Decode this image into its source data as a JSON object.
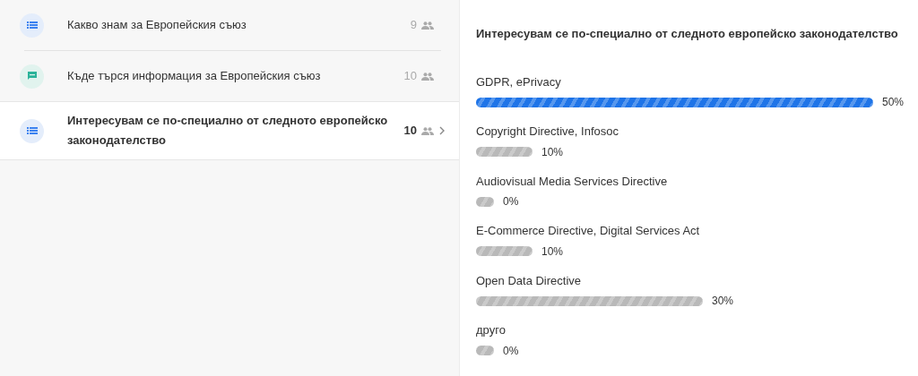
{
  "questions": [
    {
      "kind": "list",
      "title": "Какво знам за Европейския съюз",
      "count": "9",
      "selected": false
    },
    {
      "kind": "chat",
      "title": "Къде търся информация за Европейския съюз",
      "count": "10",
      "selected": false
    },
    {
      "kind": "list",
      "title": "Интересувам се по-специално от следното европейско законодателство",
      "count": "10",
      "selected": true
    }
  ],
  "results": {
    "title": "Интересувам се по-специално от следното европейско законодателство",
    "options": [
      {
        "label": "GDPR, ePrivacy",
        "reading": "50%",
        "leading": true
      },
      {
        "label": "Copyright Directive, Infosoc",
        "reading": "10%",
        "leading": false
      },
      {
        "label": "Audiovisual Media Services Directive",
        "reading": "0%",
        "leading": false
      },
      {
        "label": "E-Commerce Directive, Digital Services Act",
        "reading": "10%",
        "leading": false
      },
      {
        "label": "Open Data Directive",
        "reading": "30%",
        "leading": false
      },
      {
        "label": "друго",
        "reading": "0%",
        "leading": false
      }
    ]
  }
}
